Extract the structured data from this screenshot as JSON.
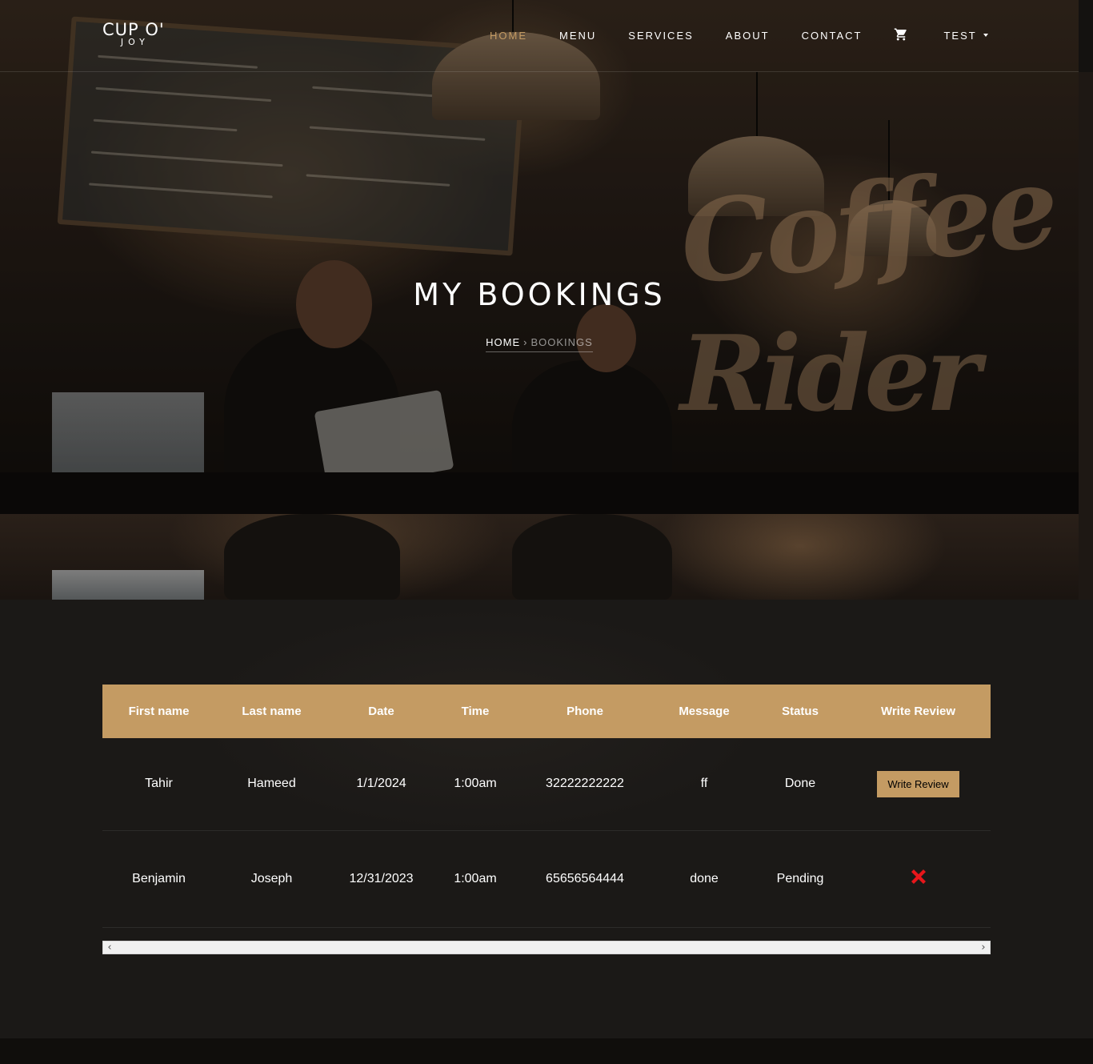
{
  "brand": {
    "line1": "CUP O'",
    "line2": "JOY"
  },
  "nav": {
    "links": [
      {
        "label": "HOME"
      },
      {
        "label": "MENU"
      },
      {
        "label": "SERVICES"
      },
      {
        "label": "ABOUT"
      },
      {
        "label": "CONTACT"
      }
    ],
    "cart_icon": "cart-icon",
    "user_label": "TEST"
  },
  "hero": {
    "title": "MY BOOKINGS",
    "breadcrumb_home": "HOME",
    "breadcrumb_current": "BOOKINGS"
  },
  "scene": {
    "sign_line1": "Coffee",
    "sign_line2": "Rider"
  },
  "table": {
    "headers": [
      "First name",
      "Last name",
      "Date",
      "Time",
      "Phone",
      "Message",
      "Status",
      "Write Review"
    ],
    "rows": [
      {
        "first": "Tahir",
        "last": "Hameed",
        "date": "1/1/2024",
        "time": "1:00am",
        "phone": "32222222222",
        "message": "ff",
        "status": "Done",
        "review": "Write Review"
      },
      {
        "first": "Benjamin",
        "last": "Joseph",
        "date": "12/31/2023",
        "time": "1:00am",
        "phone": "65656564444",
        "message": "done",
        "status": "Pending",
        "review_icon": "x-icon"
      }
    ]
  },
  "colors": {
    "accent": "#c49b63",
    "x_red": "#e8161b"
  }
}
